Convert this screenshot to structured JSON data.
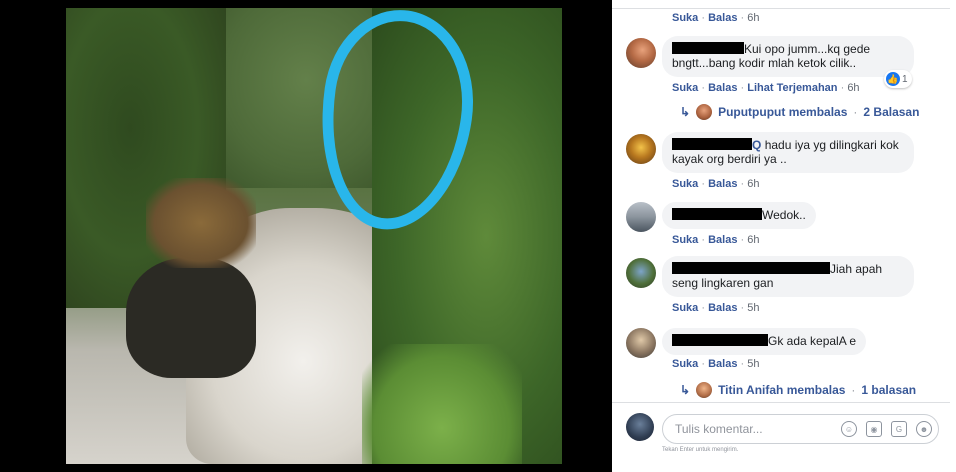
{
  "comments": [
    {
      "actions": {
        "like": "Suka",
        "reply": "Balas",
        "time": "6h"
      }
    },
    {
      "text": "Kui opo jumm...kq gede bngtt...bang kodir mlah ketok cilik..",
      "reaction_count": "1",
      "actions": {
        "like": "Suka",
        "reply": "Balas",
        "translate": "Lihat Terjemahan",
        "time": "6h"
      },
      "reply_summary": {
        "name_text": "Puputpuput membalas",
        "count": "2 Balasan"
      }
    },
    {
      "tag": "Q",
      "text": "hadu iya yg dilingkari kok kayak org berdiri ya ..",
      "actions": {
        "like": "Suka",
        "reply": "Balas",
        "time": "6h"
      }
    },
    {
      "text": "Wedok..",
      "actions": {
        "like": "Suka",
        "reply": "Balas",
        "time": "6h"
      }
    },
    {
      "text": "Jiah apah seng lingkaren gan",
      "actions": {
        "like": "Suka",
        "reply": "Balas",
        "time": "5h"
      }
    },
    {
      "text": "Gk ada kepalA e",
      "actions": {
        "like": "Suka",
        "reply": "Balas",
        "time": "5h"
      },
      "reply_summary": {
        "name_text": "Titin Anifah membalas",
        "count": "1 balasan"
      }
    }
  ],
  "composer": {
    "placeholder": "Tulis komentar...",
    "hint": "Tekan Enter untuk mengirim."
  },
  "icons": {
    "reaction": "like-icon",
    "reply_arrow": "reply-arrow-icon",
    "composer_tools": [
      "emoji-icon",
      "camera-icon",
      "gif-icon",
      "sticker-icon"
    ]
  },
  "colors": {
    "link": "#385898",
    "bubble": "#f2f3f5",
    "annotation_circle": "#29b6ea",
    "like": "#1877f2"
  }
}
